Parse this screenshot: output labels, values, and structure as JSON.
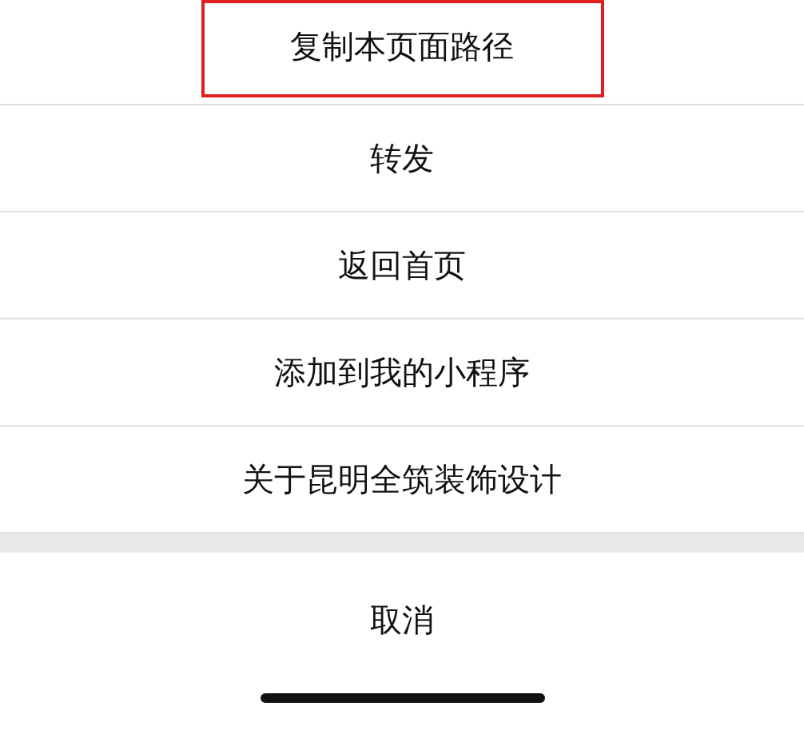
{
  "menu_items": [
    {
      "label": "复制本页面路径",
      "highlighted": true
    },
    {
      "label": "转发",
      "highlighted": false
    },
    {
      "label": "返回首页",
      "highlighted": false
    },
    {
      "label": "添加到我的小程序",
      "highlighted": false
    },
    {
      "label": "关于昆明全筑装饰设计",
      "highlighted": false
    }
  ],
  "cancel_button": "取消"
}
